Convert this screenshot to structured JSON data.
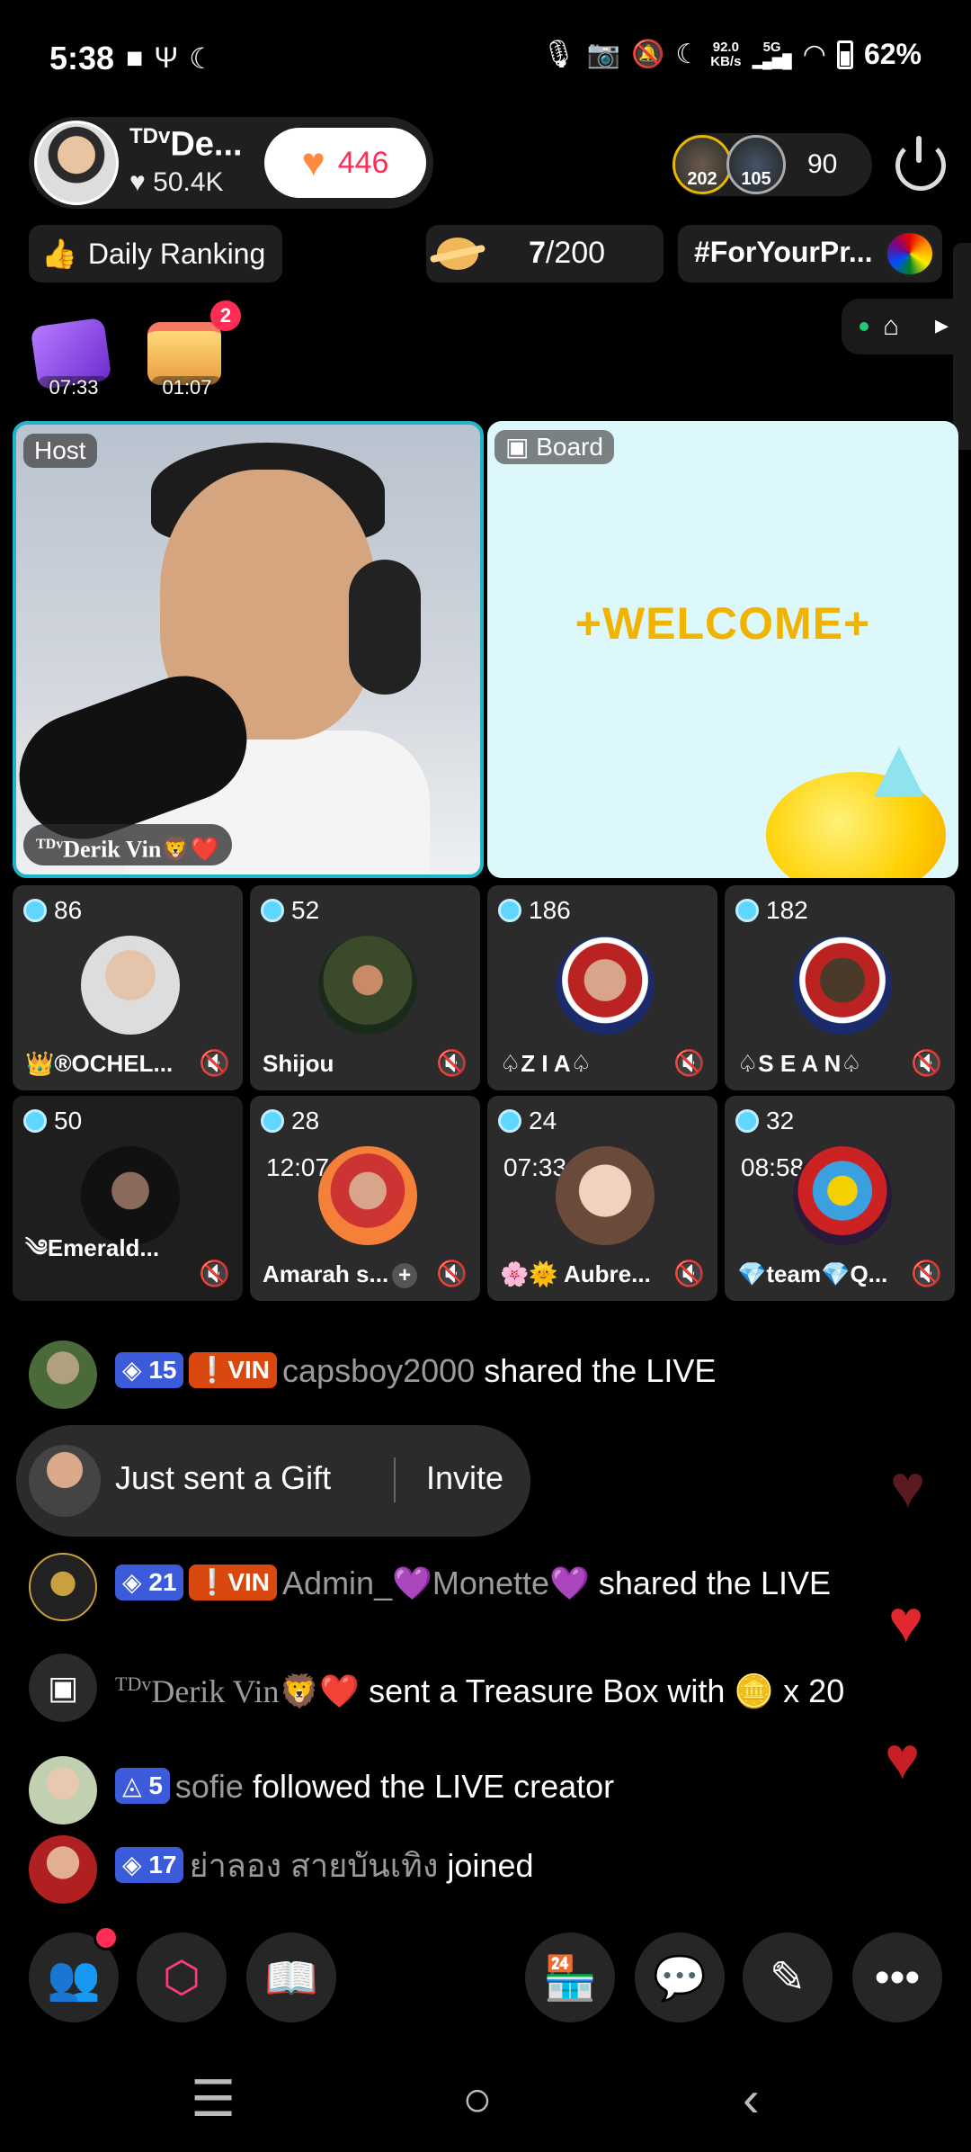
{
  "status_bar": {
    "time": "5:38",
    "net_speed_top": "92.0",
    "net_speed_bottom": "KB/s",
    "net_type": "5G",
    "battery": "62%"
  },
  "host": {
    "name_prefix": "TDv",
    "name": "De...",
    "likes": "♥ 50.4K",
    "like_count": "446"
  },
  "viewers": {
    "badge1": "202",
    "badge2": "105",
    "count": "90"
  },
  "ranking": {
    "label": "Daily Ranking"
  },
  "planet": {
    "current": "7",
    "total": "/200"
  },
  "hashtag": {
    "label": "#ForYourPr..."
  },
  "gifts": [
    {
      "timer": "07:33"
    },
    {
      "timer": "01:07",
      "badge": "2"
    }
  ],
  "tiles": {
    "host_label": "Host",
    "host_prefix": "TDv",
    "host_name": "Derik Vin🦁❤️",
    "board_label": "Board",
    "board_text": "+WELCOME+"
  },
  "guests": [
    {
      "count": "86",
      "name": "👑®OCHEL..."
    },
    {
      "count": "52",
      "name": "Shijou"
    },
    {
      "count": "186",
      "name": "♤Z I A♤"
    },
    {
      "count": "182",
      "name": "♤S E A N♤"
    },
    {
      "count": "50",
      "name": "༄Emerald..."
    },
    {
      "count": "28",
      "timer": "12:07",
      "name": "Amarah s..."
    },
    {
      "count": "24",
      "timer": "07:33",
      "name": "🌸🌞 Aubre..."
    },
    {
      "count": "32",
      "timer": "08:58",
      "name": "💎team💎Q..."
    }
  ],
  "chat": [
    {
      "level": "15",
      "badge": "VIN",
      "user": "capsboy2000",
      "text": " shared the LIVE"
    },
    {
      "level": "21",
      "badge": "VIN",
      "user": "Admin_💜Monette💜",
      "text": " shared the LIVE"
    },
    {
      "prefix": "TDv",
      "user": "Derik Vin🦁❤️",
      "text": " sent a Treasure Box with 🪙 x 20"
    },
    {
      "level": "5",
      "user": "sofie",
      "text": " followed the LIVE creator"
    },
    {
      "level": "17",
      "user": "ย่าลอง  สายบันเทิง",
      "text": " joined"
    }
  ],
  "gift_pill": {
    "text": "Just sent a Gift",
    "action": "Invite"
  },
  "colors": {
    "accent_cyan": "#1fb5c9",
    "like_pink": "#ff2d55",
    "welcome_gold": "#f0b400"
  }
}
